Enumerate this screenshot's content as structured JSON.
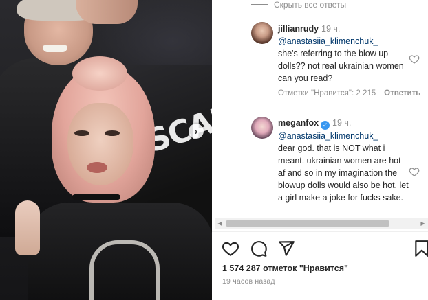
{
  "comments_panel": {
    "hide_replies_label": "Скрыть все ответы",
    "comments": [
      {
        "username": "jillianrudy",
        "time": "19 ч.",
        "mention": "@anastasiia_klimenchuk_",
        "text": "she's referring to the blow up dolls?? not real ukrainian women can you read?",
        "likes_label": "Отметки \"Нравится\": 2 215",
        "reply_label": "Ответить",
        "verified": false
      },
      {
        "username": "meganfox",
        "time": "19 ч.",
        "mention": "@anastasiia_klimenchuk_",
        "text": "dear god. that is NOT what i meant. ukrainian women are hot af and so in my imagination the blowup dolls would also be hot. let a girl make a joke for fucks sake.",
        "verified": true
      }
    ]
  },
  "post": {
    "likes_text": "1 574 287 отметок \"Нравится\"",
    "time_ago": "19 часов назад"
  },
  "photo": {
    "jacket_text": "SCAR"
  },
  "icons": {
    "like": "heart-outline-icon",
    "comment": "comment-bubble-icon",
    "share": "paper-plane-icon",
    "save": "bookmark-icon",
    "next": "chevron-right-icon",
    "verified": "verified-badge-icon"
  },
  "colors": {
    "text": "#262626",
    "secondary": "#8e8e8e",
    "mention": "#00376b",
    "verified": "#3897f0"
  }
}
